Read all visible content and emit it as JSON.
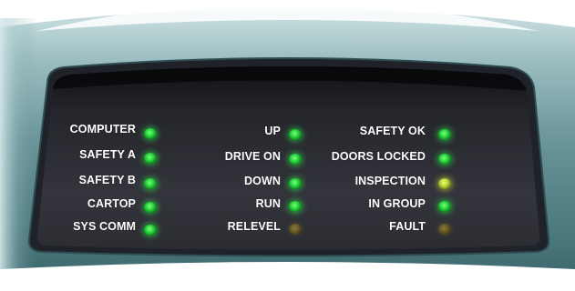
{
  "indicator_panel": {
    "columns": [
      {
        "rows": [
          {
            "label": "COMPUTER",
            "state": "green"
          },
          {
            "label": "SAFETY A",
            "state": "green"
          },
          {
            "label": "SAFETY B",
            "state": "green"
          },
          {
            "label": "CARTOP",
            "state": "green"
          },
          {
            "label": "SYS COMM",
            "state": "green"
          }
        ]
      },
      {
        "rows": [
          {
            "label": "UP",
            "state": "green"
          },
          {
            "label": "DRIVE ON",
            "state": "green"
          },
          {
            "label": "DOWN",
            "state": "green"
          },
          {
            "label": "RUN",
            "state": "green"
          },
          {
            "label": "RELEVEL",
            "state": "amber"
          }
        ]
      },
      {
        "rows": [
          {
            "label": "SAFETY OK",
            "state": "green"
          },
          {
            "label": "DOORS LOCKED",
            "state": "green"
          },
          {
            "label": "INSPECTION",
            "state": "yellow"
          },
          {
            "label": "IN GROUP",
            "state": "green"
          },
          {
            "label": "FAULT",
            "state": "amber"
          }
        ]
      }
    ]
  },
  "colors": {
    "bezel": "#6f9a9f",
    "bezel_highlight": "#b9d6d8",
    "screen": "#2a2b31",
    "led_green": "#25d23a",
    "led_yellow": "#c8d23a",
    "led_amber": "#5e5224"
  }
}
